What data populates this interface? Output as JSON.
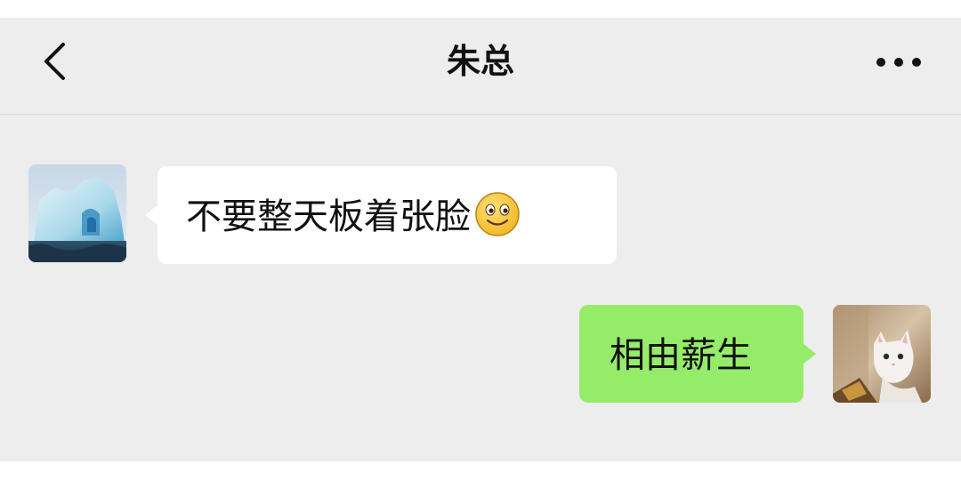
{
  "header": {
    "title": "朱总",
    "back_icon": "chevron-left-icon",
    "more_icon": "more-dots-icon"
  },
  "messages": [
    {
      "side": "left",
      "text": "不要整天板着张脸",
      "emoji": "smile-emoji-icon",
      "avatar": "iceberg-avatar",
      "bubble_color": "#ffffff"
    },
    {
      "side": "right",
      "text": "相由薪生",
      "avatar": "white-cat-avatar",
      "bubble_color": "#95ec69"
    }
  ],
  "colors": {
    "background": "#ededed",
    "self_bubble": "#95ec69",
    "other_bubble": "#ffffff"
  }
}
